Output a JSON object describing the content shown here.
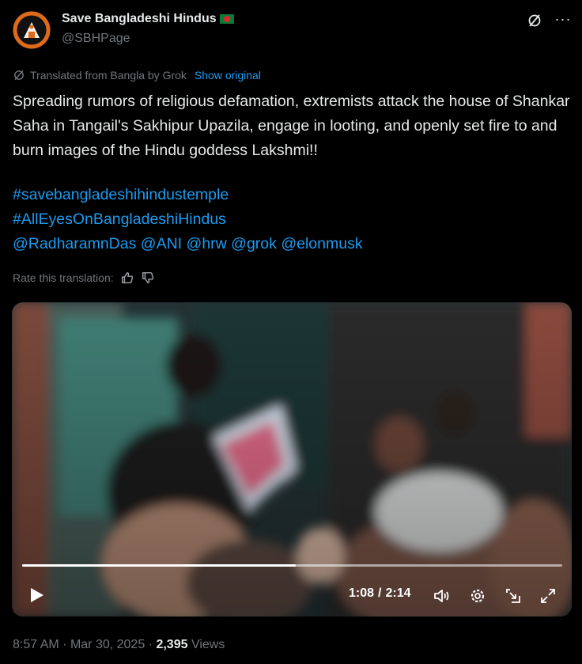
{
  "author": {
    "name": "Save Bangladeshi Hindus",
    "handle": "@SBHPage",
    "avatar_text": "SAVE BANGLADESHI HINDUS"
  },
  "translation": {
    "label": "Translated from Bangla by Grok",
    "show_original": "Show original"
  },
  "tweet": {
    "text": "Spreading rumors of religious defamation, extremists attack the house of Shankar Saha in Tangail's Sakhipur Upazila, engage in looting, and openly set fire to and burn images of the Hindu goddess Lakshmi!!",
    "hashtags": [
      "#savebangladeshihindustemple",
      "#AllEyesOnBangladeshiHindus"
    ],
    "mentions": [
      "@RadharamnDas",
      "@ANI",
      "@hrw",
      "@grok",
      "@elonmusk"
    ]
  },
  "rate": {
    "label": "Rate this translation:"
  },
  "video": {
    "current_time": "1:08",
    "separator": "/",
    "duration": "2:14",
    "progress": 0.507
  },
  "meta": {
    "time": "8:57 AM",
    "date": "Mar 30, 2025",
    "dot": "·",
    "views_count": "2,395",
    "views_label": "Views"
  },
  "colors": {
    "accent": "#1d9bf0",
    "text": "#e7e9ea",
    "muted": "#71767b",
    "background": "#000000"
  },
  "icons": [
    "grok-icon",
    "more-icon",
    "thumbs-up-icon",
    "thumbs-down-icon",
    "play-icon",
    "volume-icon",
    "settings-icon",
    "pip-icon",
    "fullscreen-icon"
  ]
}
